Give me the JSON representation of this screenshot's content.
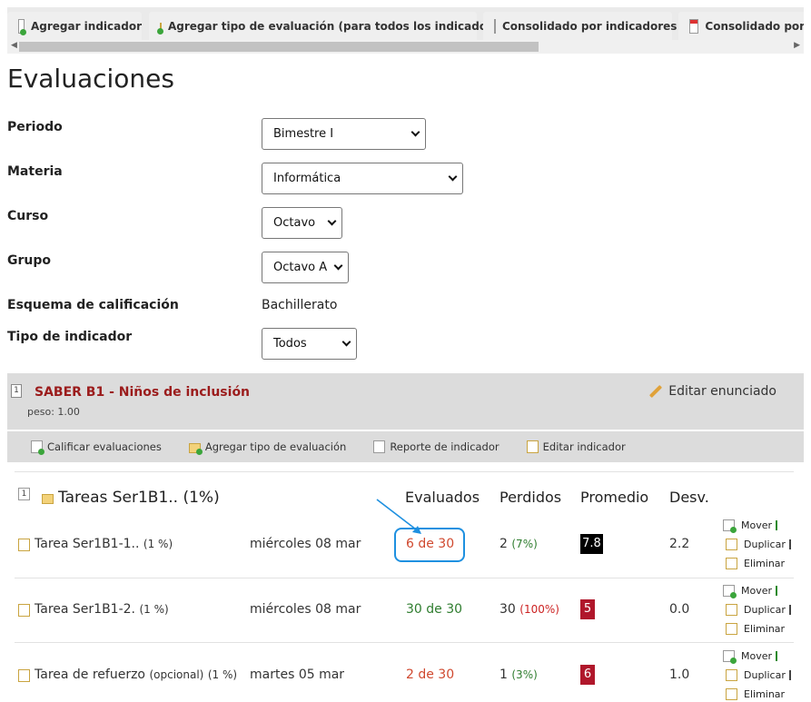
{
  "tabs": [
    {
      "label": "Agregar indicador",
      "icon": "page-add-icon"
    },
    {
      "label": "Agregar tipo de evaluación (para todos los indicadores)",
      "icon": "envelope-add-icon"
    },
    {
      "label": "Consolidado por indicadores",
      "icon": "page-icon"
    },
    {
      "label": "Consolidado por pe",
      "icon": "calendar-icon"
    }
  ],
  "page_title": "Evaluaciones",
  "form": {
    "periodo": {
      "label": "Periodo",
      "value": "Bimestre I"
    },
    "materia": {
      "label": "Materia",
      "value": "Informática"
    },
    "curso": {
      "label": "Curso",
      "value": "Octavo"
    },
    "grupo": {
      "label": "Grupo",
      "value": "Octavo A"
    },
    "esquema": {
      "label": "Esquema de calificación",
      "value": "Bachillerato"
    },
    "tipo": {
      "label": "Tipo de indicador",
      "value": "Todos"
    }
  },
  "indicator": {
    "number": "1",
    "title": "SABER B1 - Niños de inclusión",
    "peso": "peso: 1.00",
    "edit_label": "Editar enunciado"
  },
  "toolbar": {
    "calificar": "Calificar evaluaciones",
    "agregar_tipo": "Agregar tipo de evaluación",
    "reporte": "Reporte de indicador",
    "editar": "Editar indicador"
  },
  "table": {
    "group_number": "1",
    "group_title": "Tareas Ser1B1.. (1%)",
    "headers": {
      "evaluados": "Evaluados",
      "perdidos": "Perdidos",
      "promedio": "Promedio",
      "desv": "Desv."
    },
    "rows": [
      {
        "name": "Tarea Ser1B1-1..",
        "pct": "(1 %)",
        "date": "miércoles 08 mar",
        "evaluados": "6 de 30",
        "perdidos": "2",
        "perdidos_pct": "(7%)",
        "promedio": "7.8",
        "desv": "2.2"
      },
      {
        "name": "Tarea Ser1B1-2.",
        "pct": "(1 %)",
        "date": "miércoles 08 mar",
        "evaluados": "30 de 30",
        "perdidos": "30",
        "perdidos_pct": "(100%)",
        "promedio": "5",
        "desv": "0.0"
      },
      {
        "name": "Tarea de refuerzo",
        "opt": "(opcional)",
        "pct": "(1 %)",
        "date": "martes 05 mar",
        "evaluados": "2 de 30",
        "perdidos": "1",
        "perdidos_pct": "(3%)",
        "promedio": "6",
        "desv": "1.0"
      }
    ],
    "actions": {
      "mover": "Mover",
      "duplicar": "Duplicar",
      "eliminar": "Eliminar"
    }
  },
  "colors": {
    "badge_black": "#000000",
    "badge_red": "#b0172b",
    "highlight": "#1e90e0",
    "indicator_title": "#9b1c1c"
  }
}
